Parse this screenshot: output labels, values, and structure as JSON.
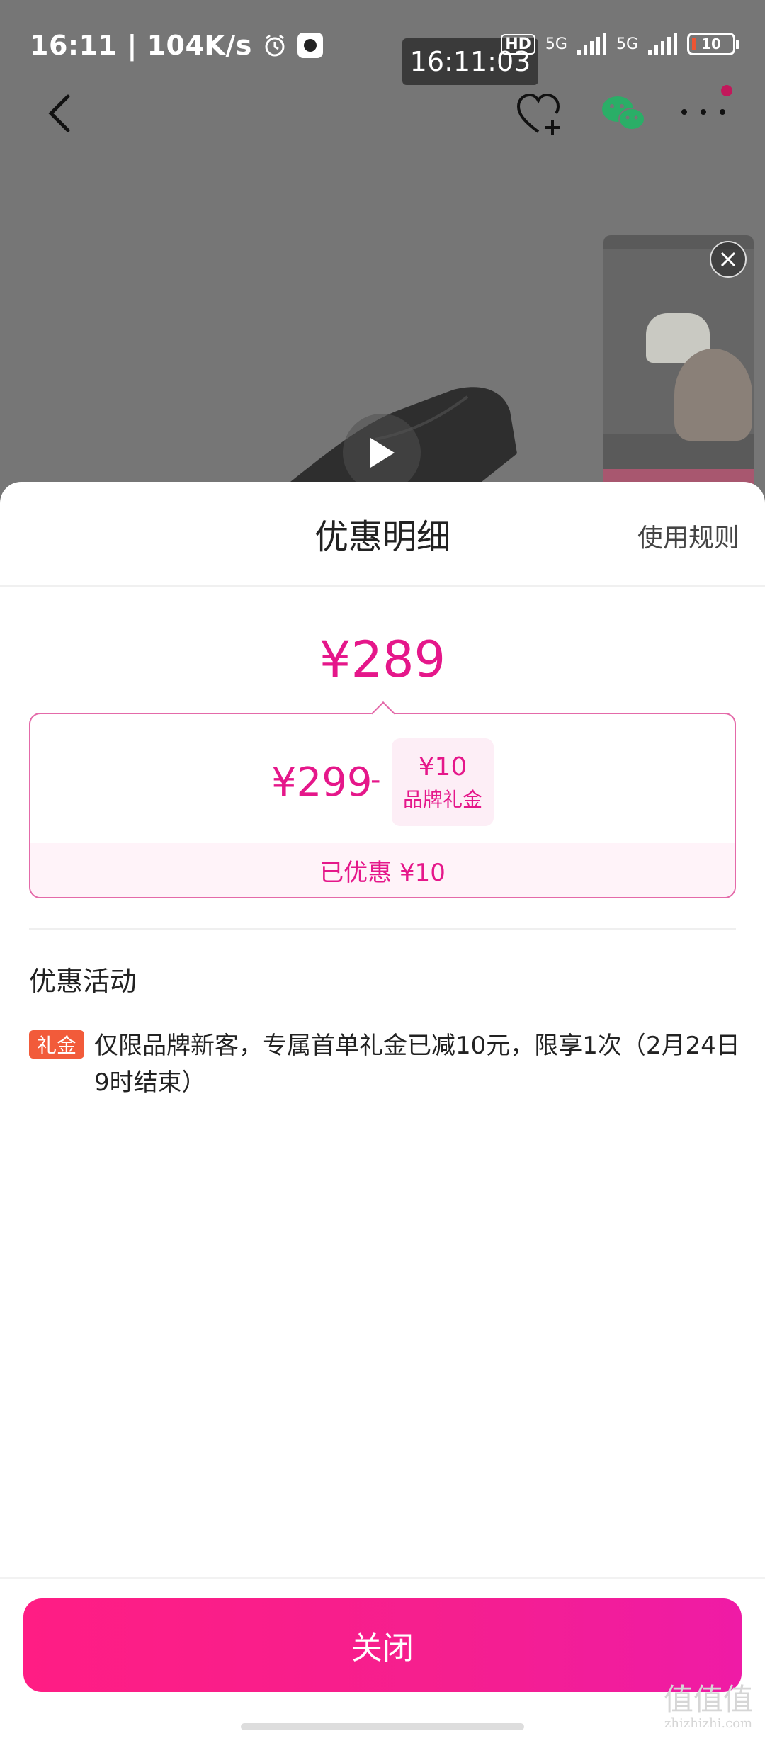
{
  "status_bar": {
    "time": "16:11",
    "speed": "| 104K/s",
    "overlay_time": "16:11:03",
    "network_hd": "HD",
    "network_5g_1": "5G",
    "network_5g_2": "5G",
    "battery": "10"
  },
  "sheet": {
    "title": "优惠明细",
    "rules_link": "使用规则",
    "final_price": "¥289",
    "original_price": "¥299",
    "minus": "-",
    "coupon_amount": "¥10",
    "coupon_type": "品牌礼金",
    "saved_text": "已优惠 ¥10",
    "section_title": "优惠活动",
    "promo_tag": "礼金",
    "promo_text": "仅限品牌新客，专属首单礼金已减10元，限享1次（2月24日9时结束）",
    "close_button": "关闭"
  },
  "watermark": {
    "main": "值值值",
    "sub": "zhizhizhi.com"
  },
  "colors": {
    "accent": "#e5178a",
    "tag": "#f25b3a",
    "button_gradient_start": "#ff1d84",
    "button_gradient_end": "#ef1ba6"
  }
}
